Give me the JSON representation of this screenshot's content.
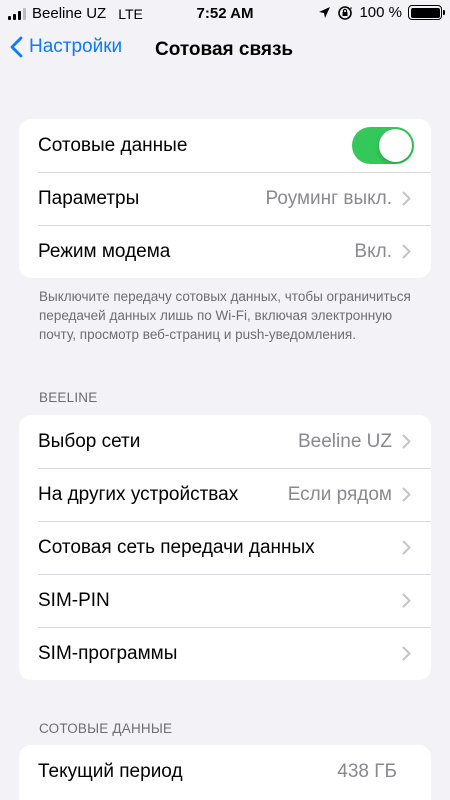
{
  "status": {
    "carrier": "Beeline UZ",
    "network": "LTE",
    "time": "7:52 AM",
    "battery_label": "100 %",
    "battery_level": 1.0
  },
  "nav": {
    "back_label": "Настройки",
    "title": "Сотовая связь"
  },
  "group1": {
    "cellular_data_label": "Сотовые данные",
    "cellular_data_on": true,
    "options_label": "Параметры",
    "options_value": "Роуминг выкл.",
    "hotspot_label": "Режим модема",
    "hotspot_value": "Вкл."
  },
  "footnote": "Выключите передачу сотовых данных, чтобы ограничиться передачей данных лишь по Wi-Fi, включая электронную почту, просмотр веб-страниц и push-уведомления.",
  "carrier_section": {
    "header": "BEELINE",
    "network_select_label": "Выбор сети",
    "network_select_value": "Beeline UZ",
    "other_devices_label": "На других устройствах",
    "other_devices_value": "Если рядом",
    "cellular_network_label": "Сотовая сеть передачи данных",
    "sim_pin_label": "SIM-PIN",
    "sim_apps_label": "SIM-программы"
  },
  "usage_section": {
    "header": "СОТОВЫЕ ДАННЫЕ",
    "current_period_label": "Текущий период",
    "current_period_value": "438 ГБ"
  },
  "colors": {
    "accent": "#0a7aff",
    "toggle_on": "#34c759",
    "background": "#f2f2f7"
  }
}
